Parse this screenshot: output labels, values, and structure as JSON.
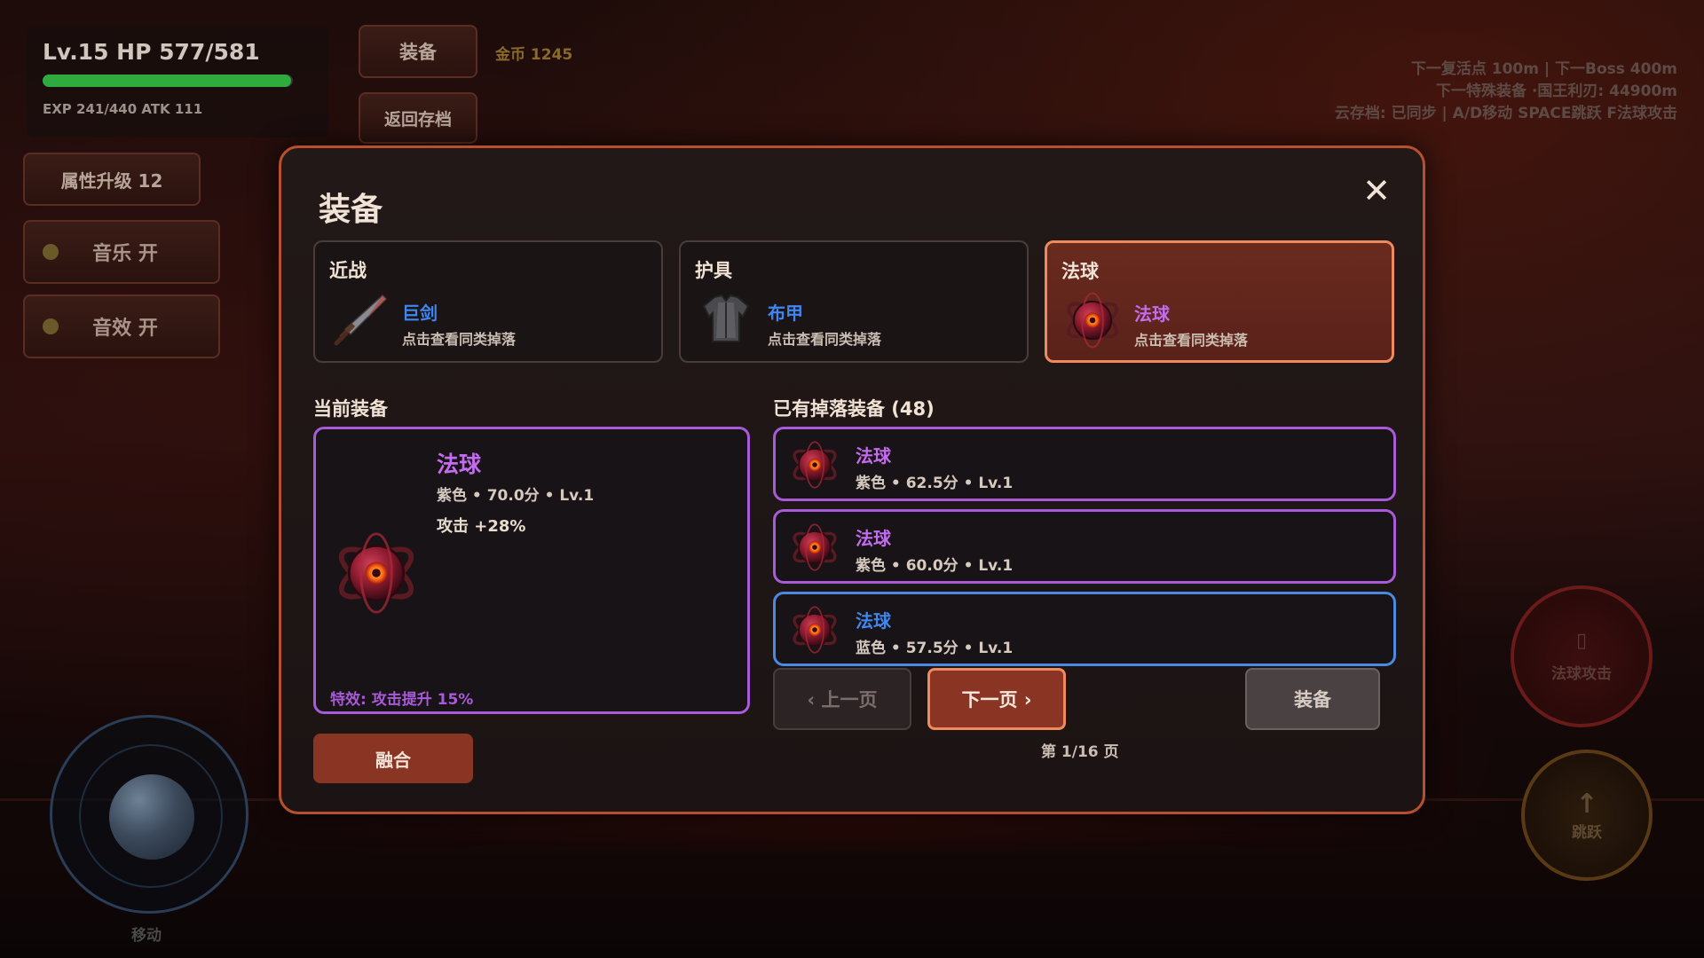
{
  "hud": {
    "level_hp": "Lv.15 HP 577/581",
    "hp_fraction": 0.993,
    "exp_atk": "EXP 241/440  ATK 111",
    "equip_button": "装备",
    "gold": "金币 1245",
    "back_button": "返回存档",
    "upgrade_button": "属性升级 12",
    "music_toggle": "音乐 开",
    "sfx_toggle": "音效 开",
    "top_right": [
      "下一复活点 100m | 下一Boss 400m",
      "下一特殊装备 ·国王利刃: 44900m",
      "云存档: 已同步 | A/D移动 SPACE跳跃 F法球攻击"
    ],
    "joystick_label": "移动",
    "orb_attack_label": "法球攻击",
    "orb_attack_icon": "▯",
    "jump_arrow": "↑",
    "jump_label": "跳跃"
  },
  "modal": {
    "title": "装备",
    "close": "✕",
    "slots": [
      {
        "category": "近战",
        "item": "巨剑",
        "hint": "点击查看同类掉落",
        "item_color": "#3f86f0",
        "icon": "sword-icon"
      },
      {
        "category": "护具",
        "item": "布甲",
        "hint": "点击查看同类掉落",
        "item_color": "#3f86f0",
        "icon": "armor-icon"
      },
      {
        "category": "法球",
        "item": "法球",
        "hint": "点击查看同类掉落",
        "item_color": "#c46cf0",
        "icon": "orb-icon"
      }
    ],
    "current_label": "当前装备",
    "current": {
      "name": "法球",
      "meta": "紫色 • 70.0分 • Lv.1",
      "stat": "攻击 +28%",
      "effect": "特效: 攻击提升 15%"
    },
    "fuse_button": "融合",
    "drops_label": "已有掉落装备 (48)",
    "drops": [
      {
        "name": "法球",
        "meta": "紫色 • 62.5分 • Lv.1",
        "rarity": "purple",
        "name_color": "#c46cf0"
      },
      {
        "name": "法球",
        "meta": "紫色 • 60.0分 • Lv.1",
        "rarity": "purple",
        "name_color": "#c46cf0"
      },
      {
        "name": "法球",
        "meta": "蓝色 • 57.5分 • Lv.1",
        "rarity": "blue",
        "name_color": "#3f86f0"
      }
    ],
    "prev_button": "‹ 上一页",
    "next_button": "下一页 ›",
    "equip_button": "装备",
    "page_indicator": "第 1/16 页"
  },
  "colors": {
    "accent": "#f08a5a",
    "purple": "#a85ad8",
    "blue": "#4a8ae0",
    "button_red": "#8a3424"
  }
}
